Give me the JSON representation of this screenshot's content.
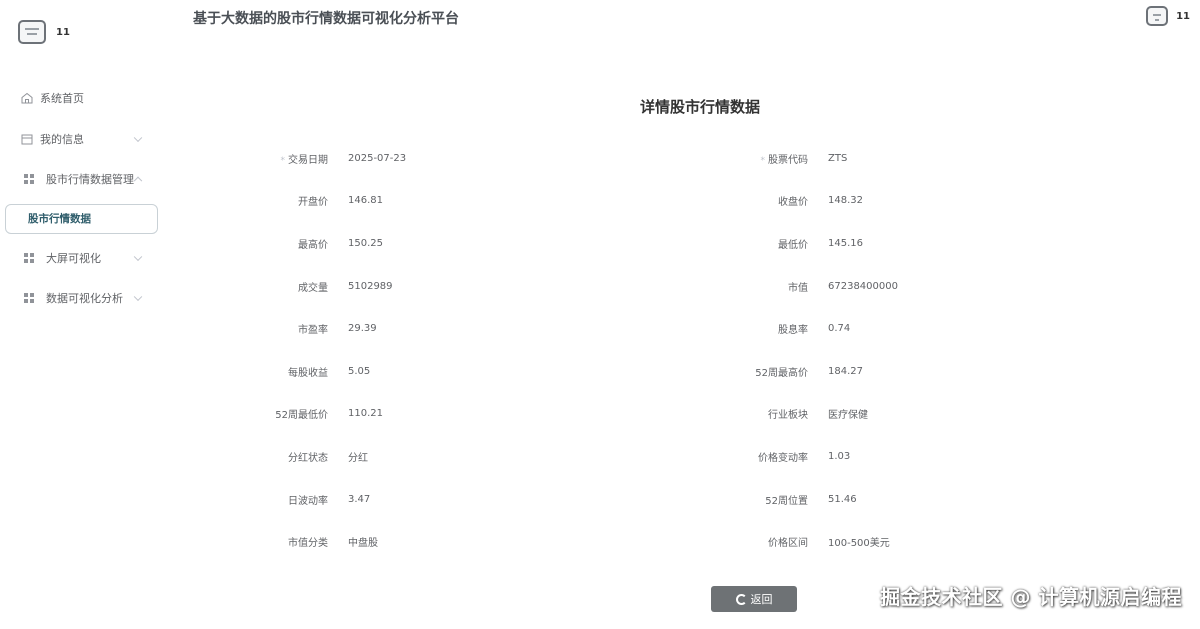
{
  "header": {
    "app_title": "基于大数据的股市行情数据可视化分析平台",
    "user_name": "11"
  },
  "sidebar": {
    "user_name": "11",
    "items": [
      {
        "label": "系统首页",
        "icon": "home-icon"
      },
      {
        "label": "我的信息",
        "icon": "calendar-icon"
      },
      {
        "label": "股市行情数据管理",
        "icon": "grid-icon"
      },
      {
        "label": "股市行情数据",
        "icon": "",
        "active": true
      },
      {
        "label": "大屏可视化",
        "icon": "grid-icon"
      },
      {
        "label": "数据可视化分析",
        "icon": "grid-icon"
      }
    ]
  },
  "detail": {
    "title": "详情股市行情数据",
    "rows": [
      {
        "left_label": "交易日期",
        "left_value": "2025-07-23",
        "right_label": "股票代码",
        "right_value": "ZTS"
      },
      {
        "left_label": "开盘价",
        "left_value": "146.81",
        "right_label": "收盘价",
        "right_value": "148.32"
      },
      {
        "left_label": "最高价",
        "left_value": "150.25",
        "right_label": "最低价",
        "right_value": "145.16"
      },
      {
        "left_label": "成交量",
        "left_value": "5102989",
        "right_label": "市值",
        "right_value": "67238400000"
      },
      {
        "left_label": "市盈率",
        "left_value": "29.39",
        "right_label": "股息率",
        "right_value": "0.74"
      },
      {
        "left_label": "每股收益",
        "left_value": "5.05",
        "right_label": "52周最高价",
        "right_value": "184.27"
      },
      {
        "left_label": "52周最低价",
        "left_value": "110.21",
        "right_label": "行业板块",
        "right_value": "医疗保健"
      },
      {
        "left_label": "分红状态",
        "left_value": "分红",
        "right_label": "价格变动率",
        "right_value": "1.03"
      },
      {
        "left_label": "日波动率",
        "left_value": "3.47",
        "right_label": "52周位置",
        "right_value": "51.46"
      },
      {
        "left_label": "市值分类",
        "left_value": "中盘股",
        "right_label": "价格区间",
        "right_value": "100-500美元"
      }
    ],
    "required_marker": "*",
    "back_label": "返回"
  },
  "watermark": "掘金技术社区 @ 计算机源启编程",
  "colors": {
    "button_bg": "#6e7275",
    "active_text": "#2f5d6b"
  }
}
